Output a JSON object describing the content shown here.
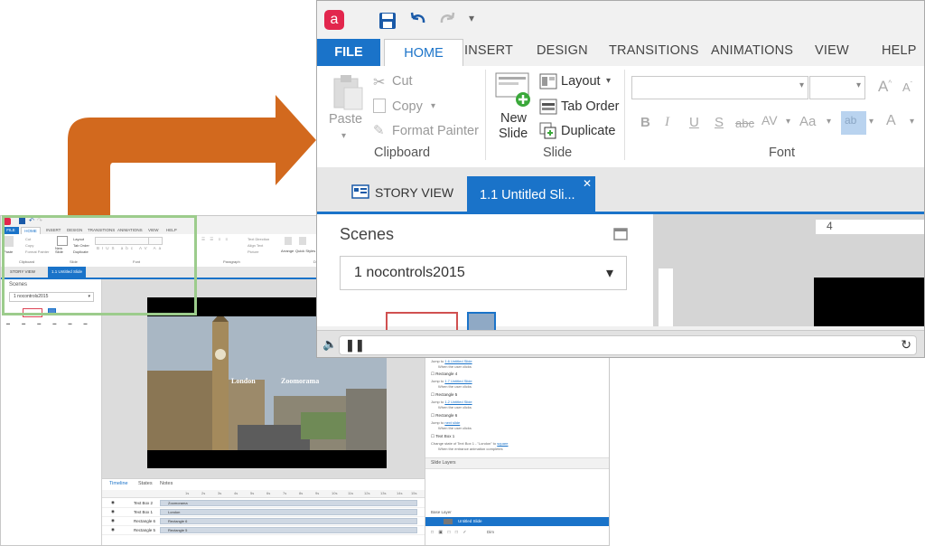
{
  "zoom": {
    "tabs": {
      "file": "FILE",
      "home": "HOME",
      "insert": "INSERT",
      "design": "DESIGN",
      "transitions": "TRANSITIONS",
      "animations": "ANIMATIONS",
      "view": "VIEW",
      "help": "HELP"
    },
    "clipboard": {
      "paste": "Paste",
      "cut": "Cut",
      "copy": "Copy",
      "format_painter": "Format Painter",
      "label": "Clipboard"
    },
    "slide": {
      "new_slide_line1": "New",
      "new_slide_line2": "Slide",
      "layout": "Layout",
      "tab_order": "Tab Order",
      "duplicate": "Duplicate",
      "label": "Slide"
    },
    "font": {
      "label": "Font",
      "bold": "B",
      "italic": "I",
      "underline": "U",
      "strike": "S",
      "abc": "abc",
      "av": "AV",
      "aa": "Aa"
    },
    "doc_tabs": {
      "story_view": "STORY VIEW",
      "untitled": "1.1 Untitled Sli..."
    },
    "scenes": {
      "title": "Scenes",
      "dropdown": "1 nocontrols2015"
    },
    "ruler_number": "4"
  },
  "small": {
    "tabs": {
      "file": "FILE",
      "home": "HOME",
      "insert": "INSERT",
      "design": "DESIGN",
      "transitions": "TRANSITIONS",
      "animations": "ANIMATIONS",
      "view": "VIEW",
      "help": "HELP"
    },
    "ribbon": {
      "paste": "Paste",
      "cut": "Cut",
      "copy": "Copy",
      "format_painter": "Format Painter",
      "clipboard": "Clipboard",
      "new_slide": "New Slide",
      "layout": "Layout",
      "tab_order": "Tab Order",
      "duplicate": "Duplicate",
      "slide": "Slide",
      "font": "Font",
      "paragraph": "Paragraph",
      "text_direction": "Text Direction",
      "align_text": "Align Text",
      "picture": "Picture",
      "drawing": "Drawing",
      "arrange": "Arrange",
      "quick_styles": "Quick Styles"
    },
    "doc_tabs": {
      "story_view": "STORY VIEW",
      "untitled": "1.1 Untitled Slide"
    },
    "scenes": {
      "title": "Scenes",
      "dropdown": "1 nocontrols2015"
    },
    "slide_captions": {
      "london": "London",
      "zoomorama": "Zoomorama"
    },
    "triggers": [
      {
        "title": "",
        "line1_prefix": "Jump to ",
        "line1_link": "1.6 Untitled Slide",
        "line2": "When the user clicks"
      },
      {
        "title": "Rectangle 4",
        "line1_prefix": "Jump to ",
        "line1_link": "1.7 Untitled Slide",
        "line2": "When the user clicks"
      },
      {
        "title": "Rectangle 5",
        "line1_prefix": "Jump to ",
        "line1_link": "1.2 Untitled Slide",
        "line2": "When the user clicks"
      },
      {
        "title": "Rectangle 6",
        "line1_prefix": "Jump to ",
        "line1_link": "next slide",
        "line2": "When the user clicks"
      },
      {
        "title": "Text Box 1",
        "line1_prefix": "Change state of Text Box 1 - \"London\" to ",
        "line1_link": "square",
        "line2": "When the entrance animation completes"
      }
    ],
    "slide_layers": "Slide Layers",
    "base_layer": "Base Layer",
    "base_layer_item": "Untitled Slide",
    "dim": "Dim",
    "timeline_tabs": {
      "timeline": "Timeline",
      "states": "States",
      "notes": "Notes"
    },
    "timeline_ticks": [
      "1s",
      "2s",
      "3s",
      "4s",
      "5s",
      "6s",
      "7s",
      "8s",
      "9s",
      "10s",
      "11s",
      "12s",
      "13s",
      "14s",
      "15s",
      "16s"
    ],
    "timeline_rows": [
      {
        "name": "Text Box 2",
        "bar": "Zoomorama"
      },
      {
        "name": "Text Box 1",
        "bar": "London"
      },
      {
        "name": "Rectangle 6",
        "bar": "Rectangle 6"
      },
      {
        "name": "Rectangle 5",
        "bar": "Rectangle 5"
      }
    ]
  },
  "colors": {
    "accent": "#1a73c9",
    "arrow": "#d2691e",
    "frame": "#9ccc8c"
  }
}
